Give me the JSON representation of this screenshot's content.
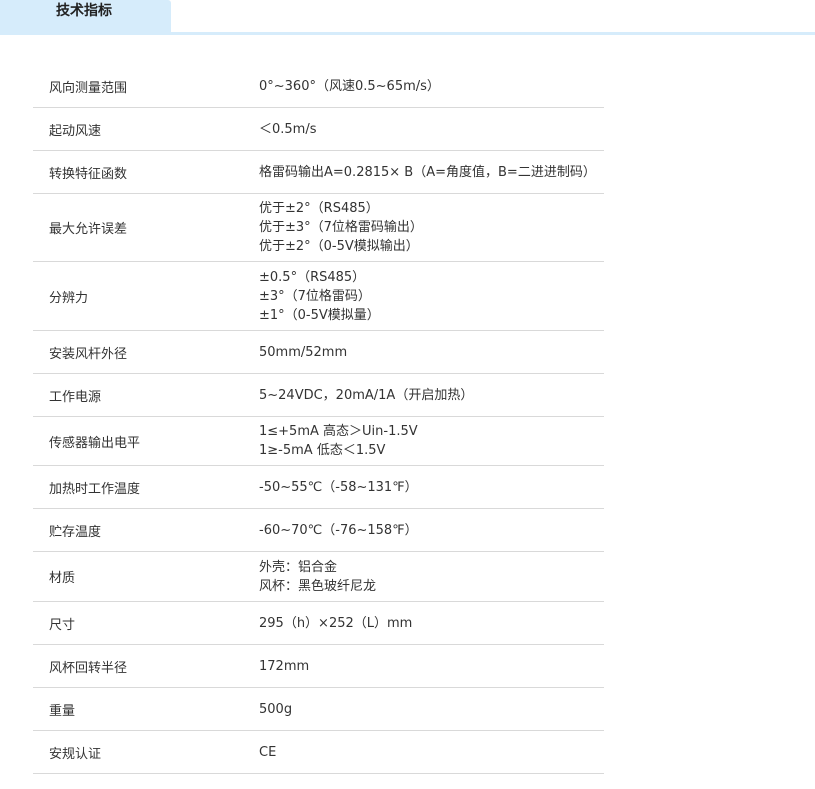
{
  "tab": {
    "label": "技术指标"
  },
  "specs": [
    {
      "label": "风向测量范围",
      "values": [
        "0°~360°（风速0.5~65m/s）"
      ]
    },
    {
      "label": "起动风速",
      "values": [
        "＜0.5m/s"
      ]
    },
    {
      "label": "转换特征函数",
      "values": [
        "格雷码输出A=0.2815× B（A=角度值，B=二进进制码）"
      ]
    },
    {
      "label": "最大允许误差",
      "values": [
        "优于±2°（RS485）",
        "优于±3°（7位格雷码输出）",
        "优于±2°（0-5V模拟输出）"
      ]
    },
    {
      "label": "分辨力",
      "values": [
        "±0.5°（RS485）",
        "±3°（7位格雷码）",
        "±1°（0-5V模拟量）"
      ]
    },
    {
      "label": "安装风杆外径",
      "values": [
        "50mm/52mm"
      ]
    },
    {
      "label": "工作电源",
      "values": [
        "5~24VDC，20mA/1A（开启加热）"
      ]
    },
    {
      "label": "传感器输出电平",
      "values": [
        "1≤+5mA 高态＞Uin-1.5V",
        "1≥-5mA 低态＜1.5V"
      ]
    },
    {
      "label": "加热时工作温度",
      "values": [
        "-50~55℃（-58~131℉）"
      ]
    },
    {
      "label": "贮存温度",
      "values": [
        "-60~70℃（-76~158℉）"
      ]
    },
    {
      "label": "材质",
      "values": [
        "外壳：铝合金",
        "风杯：黑色玻纤尼龙"
      ]
    },
    {
      "label": "尺寸",
      "values": [
        "295（h）×252（L）mm"
      ]
    },
    {
      "label": "风杯回转半径",
      "values": [
        "172mm"
      ]
    },
    {
      "label": "重量",
      "values": [
        "500g"
      ]
    },
    {
      "label": "安规认证",
      "values": [
        "CE"
      ]
    }
  ]
}
